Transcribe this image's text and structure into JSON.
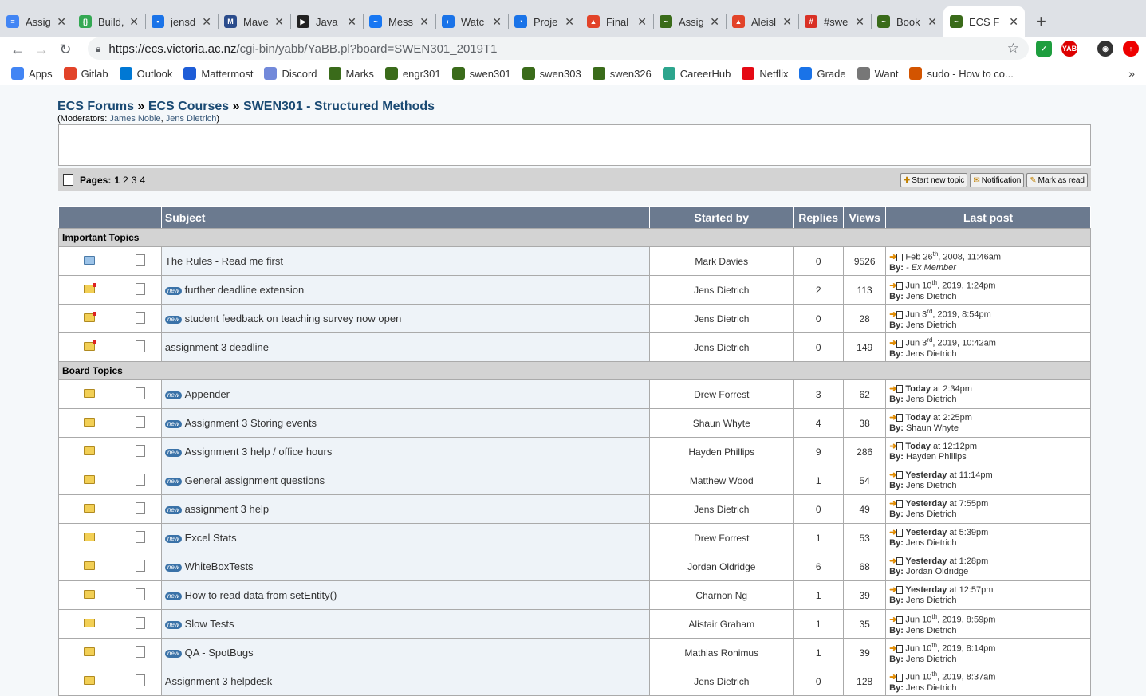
{
  "tabs": [
    {
      "title": "Assig",
      "color": "#4285f4",
      "glyph": "≡"
    },
    {
      "title": "Build,",
      "color": "#34a853",
      "glyph": "{}"
    },
    {
      "title": "jensd",
      "color": "#1a73e8",
      "glyph": "▪"
    },
    {
      "title": "Mave",
      "color": "#2b4c8c",
      "glyph": "M"
    },
    {
      "title": "Java",
      "color": "#222222",
      "glyph": "▶"
    },
    {
      "title": "Mess",
      "color": "#1877f2",
      "glyph": "~"
    },
    {
      "title": "Watc",
      "color": "#1a73e8",
      "glyph": "◐"
    },
    {
      "title": "Proje",
      "color": "#1a73e8",
      "glyph": "◔"
    },
    {
      "title": "Final",
      "color": "#e24329",
      "glyph": "▲"
    },
    {
      "title": "Assig",
      "color": "#3a6b1a",
      "glyph": "~"
    },
    {
      "title": "Aleisl",
      "color": "#e24329",
      "glyph": "▲"
    },
    {
      "title": "#swe",
      "color": "#d93025",
      "glyph": "#"
    },
    {
      "title": "Book",
      "color": "#3a6b1a",
      "glyph": "~"
    },
    {
      "title": "ECS F",
      "color": "#3a6b1a",
      "glyph": "~"
    }
  ],
  "url": {
    "domain": "https://ecs.victoria.ac.nz",
    "path": "/cgi-bin/yabb/YaBB.pl?board=SWEN301_2019T1"
  },
  "bookmarks": [
    {
      "label": "Apps",
      "color": "#4285f4"
    },
    {
      "label": "Gitlab",
      "color": "#e24329"
    },
    {
      "label": "Outlook",
      "color": "#0078d4"
    },
    {
      "label": "Mattermost",
      "color": "#1e5dd7"
    },
    {
      "label": "Discord",
      "color": "#7289da"
    },
    {
      "label": "Marks",
      "color": "#3a6b1a"
    },
    {
      "label": "engr301",
      "color": "#3a6b1a"
    },
    {
      "label": "swen301",
      "color": "#3a6b1a"
    },
    {
      "label": "swen303",
      "color": "#3a6b1a"
    },
    {
      "label": "swen326",
      "color": "#3a6b1a"
    },
    {
      "label": "CareerHub",
      "color": "#2ca58d"
    },
    {
      "label": "Netflix",
      "color": "#e50914"
    },
    {
      "label": "Grade",
      "color": "#1a73e8"
    },
    {
      "label": "Want",
      "color": "#777777"
    },
    {
      "label": "sudo - How to co...",
      "color": "#d35400"
    }
  ],
  "breadcrumb": {
    "forums": "ECS Forums",
    "courses": "ECS Courses",
    "board": "SWEN301 - Structured Methods",
    "sep": "»"
  },
  "moderators": {
    "prefix": "(Moderators: ",
    "m1": "James Noble",
    "comma": ", ",
    "m2": "Jens Dietrich",
    "suffix": ")"
  },
  "pages": {
    "label": "Pages:",
    "current": "1",
    "others": [
      "2",
      "3",
      "4"
    ]
  },
  "actions": {
    "new_topic": "Start new topic",
    "notification": "Notification",
    "mark_read": "Mark as read"
  },
  "headers": {
    "subject": "Subject",
    "started_by": "Started by",
    "replies": "Replies",
    "views": "Views",
    "last_post": "Last post"
  },
  "sections": {
    "important": "Important Topics",
    "board": "Board Topics"
  },
  "important_topics": [
    {
      "subject": "The Rules - Read me first",
      "new": false,
      "folder": "blue",
      "starter": "Mark Davies",
      "replies": "0",
      "views": "9526",
      "last_date": "Feb 26",
      "last_sup": "th",
      "last_rest": ", 2008, 11:46am",
      "last_bold": "",
      "last_by": "- Ex Member",
      "last_by_italic": true
    },
    {
      "subject": "further deadline extension",
      "new": true,
      "folder": "hot",
      "starter": "Jens Dietrich",
      "replies": "2",
      "views": "113",
      "last_date": "Jun 10",
      "last_sup": "th",
      "last_rest": ", 2019, 1:24pm",
      "last_bold": "",
      "last_by": "Jens Dietrich",
      "last_by_italic": false
    },
    {
      "subject": "student feedback on teaching survey now open",
      "new": true,
      "folder": "hot",
      "starter": "Jens Dietrich",
      "replies": "0",
      "views": "28",
      "last_date": "Jun 3",
      "last_sup": "rd",
      "last_rest": ", 2019, 8:54pm",
      "last_bold": "",
      "last_by": "Jens Dietrich",
      "last_by_italic": false
    },
    {
      "subject": "assignment 3 deadline",
      "new": false,
      "folder": "hot",
      "starter": "Jens Dietrich",
      "replies": "0",
      "views": "149",
      "last_date": "Jun 3",
      "last_sup": "rd",
      "last_rest": ", 2019, 10:42am",
      "last_bold": "",
      "last_by": "Jens Dietrich",
      "last_by_italic": false
    }
  ],
  "board_topics": [
    {
      "subject": "Appender",
      "new": true,
      "starter": "Drew Forrest",
      "replies": "3",
      "views": "62",
      "last_bold": "Today",
      "last_date": "",
      "last_sup": "",
      "last_rest": " at 2:34pm",
      "last_by": "Jens Dietrich"
    },
    {
      "subject": "Assignment 3 Storing events",
      "new": true,
      "starter": "Shaun Whyte",
      "replies": "4",
      "views": "38",
      "last_bold": "Today",
      "last_date": "",
      "last_sup": "",
      "last_rest": " at 2:25pm",
      "last_by": "Shaun Whyte"
    },
    {
      "subject": "Assignment 3 help / office hours",
      "new": true,
      "starter": "Hayden Phillips",
      "replies": "9",
      "views": "286",
      "last_bold": "Today",
      "last_date": "",
      "last_sup": "",
      "last_rest": " at 12:12pm",
      "last_by": "Hayden Phillips"
    },
    {
      "subject": "General assignment questions",
      "new": true,
      "starter": "Matthew Wood",
      "replies": "1",
      "views": "54",
      "last_bold": "Yesterday",
      "last_date": "",
      "last_sup": "",
      "last_rest": " at 11:14pm",
      "last_by": "Jens Dietrich"
    },
    {
      "subject": "assignment 3 help",
      "new": true,
      "starter": "Jens Dietrich",
      "replies": "0",
      "views": "49",
      "last_bold": "Yesterday",
      "last_date": "",
      "last_sup": "",
      "last_rest": " at 7:55pm",
      "last_by": "Jens Dietrich"
    },
    {
      "subject": "Excel Stats",
      "new": true,
      "starter": "Drew Forrest",
      "replies": "1",
      "views": "53",
      "last_bold": "Yesterday",
      "last_date": "",
      "last_sup": "",
      "last_rest": " at 5:39pm",
      "last_by": "Jens Dietrich"
    },
    {
      "subject": "WhiteBoxTests",
      "new": true,
      "starter": "Jordan Oldridge",
      "replies": "6",
      "views": "68",
      "last_bold": "Yesterday",
      "last_date": "",
      "last_sup": "",
      "last_rest": " at 1:28pm",
      "last_by": "Jordan Oldridge"
    },
    {
      "subject": "How to read data from setEntity()",
      "new": true,
      "starter": "Charnon Ng",
      "replies": "1",
      "views": "39",
      "last_bold": "Yesterday",
      "last_date": "",
      "last_sup": "",
      "last_rest": " at 12:57pm",
      "last_by": "Jens Dietrich"
    },
    {
      "subject": "Slow Tests",
      "new": true,
      "starter": "Alistair Graham",
      "replies": "1",
      "views": "35",
      "last_bold": "",
      "last_date": "Jun 10",
      "last_sup": "th",
      "last_rest": ", 2019, 8:59pm",
      "last_by": "Jens Dietrich"
    },
    {
      "subject": "QA - SpotBugs",
      "new": true,
      "starter": "Mathias Ronimus",
      "replies": "1",
      "views": "39",
      "last_bold": "",
      "last_date": "Jun 10",
      "last_sup": "th",
      "last_rest": ", 2019, 8:14pm",
      "last_by": "Jens Dietrich"
    },
    {
      "subject": "Assignment 3 helpdesk",
      "new": false,
      "starter": "Jens Dietrich",
      "replies": "0",
      "views": "128",
      "last_bold": "",
      "last_date": "Jun 10",
      "last_sup": "th",
      "last_rest": ", 2019, 8:37am",
      "last_by": "Jens Dietrich"
    }
  ],
  "labels": {
    "new_badge": "new",
    "by_prefix": "By: "
  }
}
